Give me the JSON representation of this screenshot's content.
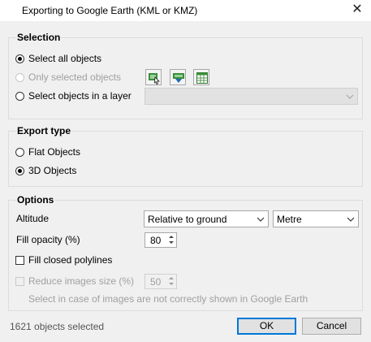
{
  "window": {
    "title": "Exporting to Google Earth (KML or KMZ)",
    "close_glyph": "✕"
  },
  "selection": {
    "title": "Selection",
    "options": [
      {
        "label": "Select all objects",
        "checked": true,
        "enabled": true
      },
      {
        "label": "Only selected objects",
        "checked": false,
        "enabled": false
      },
      {
        "label": "Select objects in a layer",
        "checked": false,
        "enabled": true
      }
    ],
    "tool_icons": [
      "select-on-map-icon",
      "select-by-filter-icon",
      "select-in-table-icon"
    ],
    "layer_combo": {
      "value": "",
      "enabled": false
    }
  },
  "export_type": {
    "title": "Export type",
    "options": [
      {
        "label": "Flat Objects",
        "checked": false
      },
      {
        "label": "3D Objects",
        "checked": true
      }
    ]
  },
  "options": {
    "title": "Options",
    "altitude_label": "Altitude",
    "altitude_value": "Relative to ground",
    "unit_value": "Metre",
    "fill_opacity_label": "Fill opacity (%)",
    "fill_opacity_value": "80",
    "fill_closed_label": "Fill closed polylines",
    "fill_closed_checked": false,
    "reduce_images_label": "Reduce images size (%)",
    "reduce_images_value": "50",
    "reduce_images_enabled": false,
    "hint": "Select in case of images are not correctly shown in Google Earth"
  },
  "footer": {
    "status": "1621 objects selected",
    "ok_label": "OK",
    "cancel_label": "Cancel"
  },
  "colors": {
    "accent": "#0078d7",
    "disabled_text": "#a0a0a0",
    "background": "#f0f0f0"
  }
}
